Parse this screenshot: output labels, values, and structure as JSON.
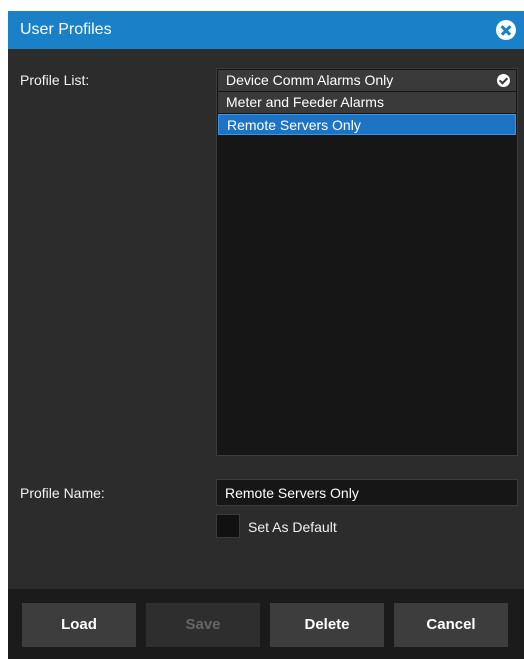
{
  "dialog": {
    "title": "User Profiles",
    "close_icon": "close-icon"
  },
  "profile_list": {
    "label": "Profile List:",
    "items": [
      {
        "label": "Device Comm Alarms Only",
        "is_default": true
      },
      {
        "label": "Meter and Feeder Alarms",
        "is_default": false
      },
      {
        "label": "Remote Servers Only",
        "is_default": false,
        "selected": true
      }
    ]
  },
  "profile_name": {
    "label": "Profile Name:",
    "value": "Remote Servers Only"
  },
  "set_default": {
    "label": "Set As Default",
    "checked": false
  },
  "buttons": {
    "load": "Load",
    "save": "Save",
    "delete": "Delete",
    "cancel": "Cancel"
  },
  "colors": {
    "titlebar": "#1a80c7",
    "selected_row": "#1d74c4",
    "panel": "#2c2c2c"
  }
}
